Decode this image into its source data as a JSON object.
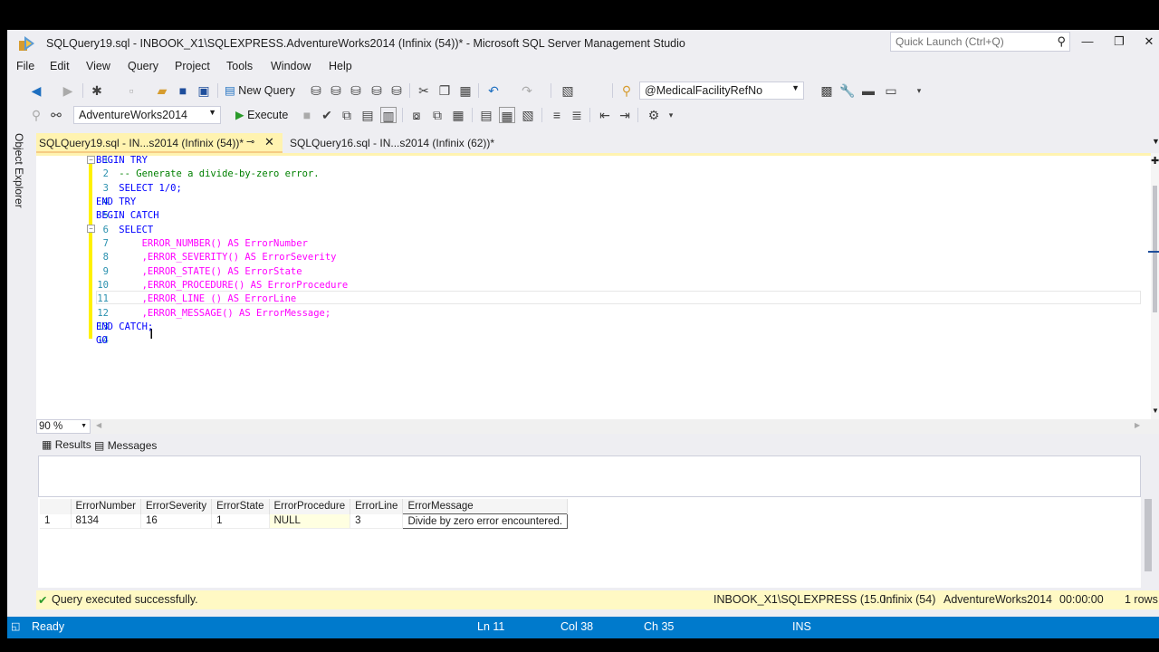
{
  "window": {
    "title": "SQLQuery19.sql - INBOOK_X1\\SQLEXPRESS.AdventureWorks2014 (Infinix (54))* - Microsoft SQL Server Management Studio",
    "quick_launch_placeholder": "Quick Launch (Ctrl+Q)",
    "controls": {
      "minimize": "—",
      "maximize": "❐",
      "close": "✕"
    }
  },
  "menu": [
    "File",
    "Edit",
    "View",
    "Query",
    "Project",
    "Tools",
    "Window",
    "Help"
  ],
  "toolbar1": {
    "new_query_label": "New Query",
    "object_combo_value": "@MedicalFacilityRefNo"
  },
  "toolbar2": {
    "database_combo_value": "AdventureWorks2014",
    "execute_label": "Execute"
  },
  "side_rail": {
    "object_explorer_label": "Object Explorer"
  },
  "tabs": [
    {
      "label": "SQLQuery19.sql - IN...s2014 (Infinix (54))*",
      "active": true
    },
    {
      "label": "SQLQuery16.sql - IN...s2014 (Infinix (62))*",
      "active": false
    }
  ],
  "editor": {
    "lines": [
      {
        "n": "1",
        "text": "BEGIN TRY"
      },
      {
        "n": "2",
        "text": "    -- Generate a divide-by-zero error."
      },
      {
        "n": "3",
        "text": "    SELECT 1/0;"
      },
      {
        "n": "4",
        "text": "END TRY"
      },
      {
        "n": "5",
        "text": "BEGIN CATCH"
      },
      {
        "n": "6",
        "text": "    SELECT"
      },
      {
        "n": "7",
        "text": "        ERROR_NUMBER() AS ErrorNumber"
      },
      {
        "n": "8",
        "text": "        ,ERROR_SEVERITY() AS ErrorSeverity"
      },
      {
        "n": "9",
        "text": "        ,ERROR_STATE() AS ErrorState"
      },
      {
        "n": "10",
        "text": "        ,ERROR_PROCEDURE() AS ErrorProcedure"
      },
      {
        "n": "11",
        "text": "        ,ERROR_LINE () AS ErrorLine"
      },
      {
        "n": "12",
        "text": "        ,ERROR_MESSAGE() AS ErrorMessage;"
      },
      {
        "n": "13",
        "text": "END CATCH;"
      },
      {
        "n": "14",
        "text": "GO"
      }
    ],
    "zoom": "90 %"
  },
  "results": {
    "tabs": {
      "results": "Results",
      "messages": "Messages"
    },
    "columns": [
      "",
      "ErrorNumber",
      "ErrorSeverity",
      "ErrorState",
      "ErrorProcedure",
      "ErrorLine",
      "ErrorMessage"
    ],
    "rows": [
      [
        "1",
        "8134",
        "16",
        "1",
        "NULL",
        "3",
        "Divide by zero error encountered."
      ]
    ]
  },
  "query_status": {
    "message": "Query executed successfully.",
    "server": "INBOOK_X1\\SQLEXPRESS (15.0 ...",
    "user": "Infinix (54)",
    "database": "AdventureWorks2014",
    "elapsed": "00:00:00",
    "rows": "1 rows"
  },
  "app_status": {
    "state": "Ready",
    "line": "Ln 11",
    "col": "Col 38",
    "ch": "Ch 35",
    "mode": "INS"
  },
  "colors": {
    "keyword": "#0000ff",
    "function": "#ff00ff",
    "comment": "#008000",
    "line_number": "#2b91af",
    "status_blue": "#007acc",
    "tab_active": "#fff3b0"
  }
}
